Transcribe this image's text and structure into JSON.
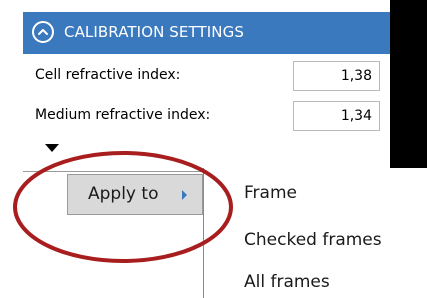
{
  "calibration": {
    "title": "CALIBRATION SETTINGS",
    "cell_label": "Cell refractive index:",
    "cell_value": "1,38",
    "medium_label": "Medium refractive index:",
    "medium_value": "1,34"
  },
  "context_menu": {
    "apply_label": "Apply to",
    "submenu": [
      "Frame",
      "Checked frames",
      "All frames"
    ]
  },
  "colors": {
    "header_bg": "#3a79bd",
    "highlight_ellipse": "#a81e1e"
  },
  "icons": {
    "collapse": "chevron-up-circle-icon",
    "expand": "triangle-down-icon",
    "submenu": "chevron-right-icon"
  }
}
